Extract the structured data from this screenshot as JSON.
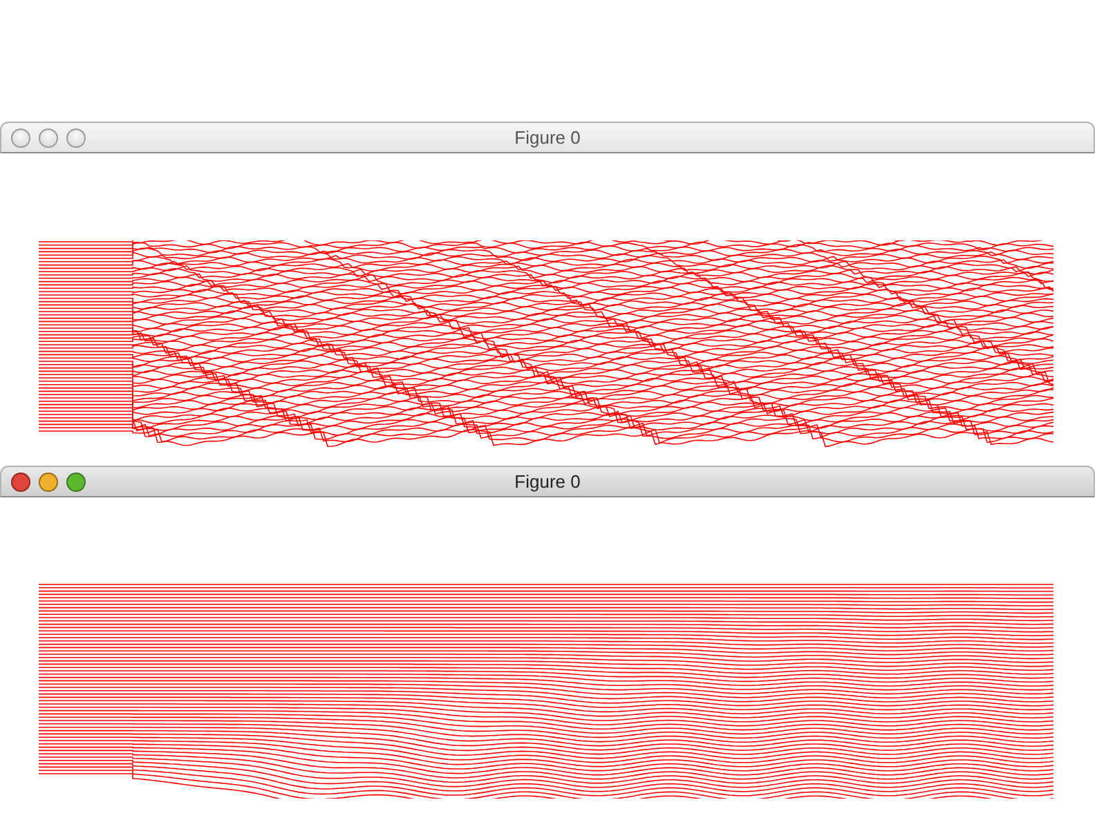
{
  "windows": [
    {
      "title": "Figure 0",
      "active": false,
      "plot": {
        "kind": "noisy"
      }
    },
    {
      "title": "Figure 0",
      "active": true,
      "plot": {
        "kind": "smooth"
      }
    }
  ]
}
